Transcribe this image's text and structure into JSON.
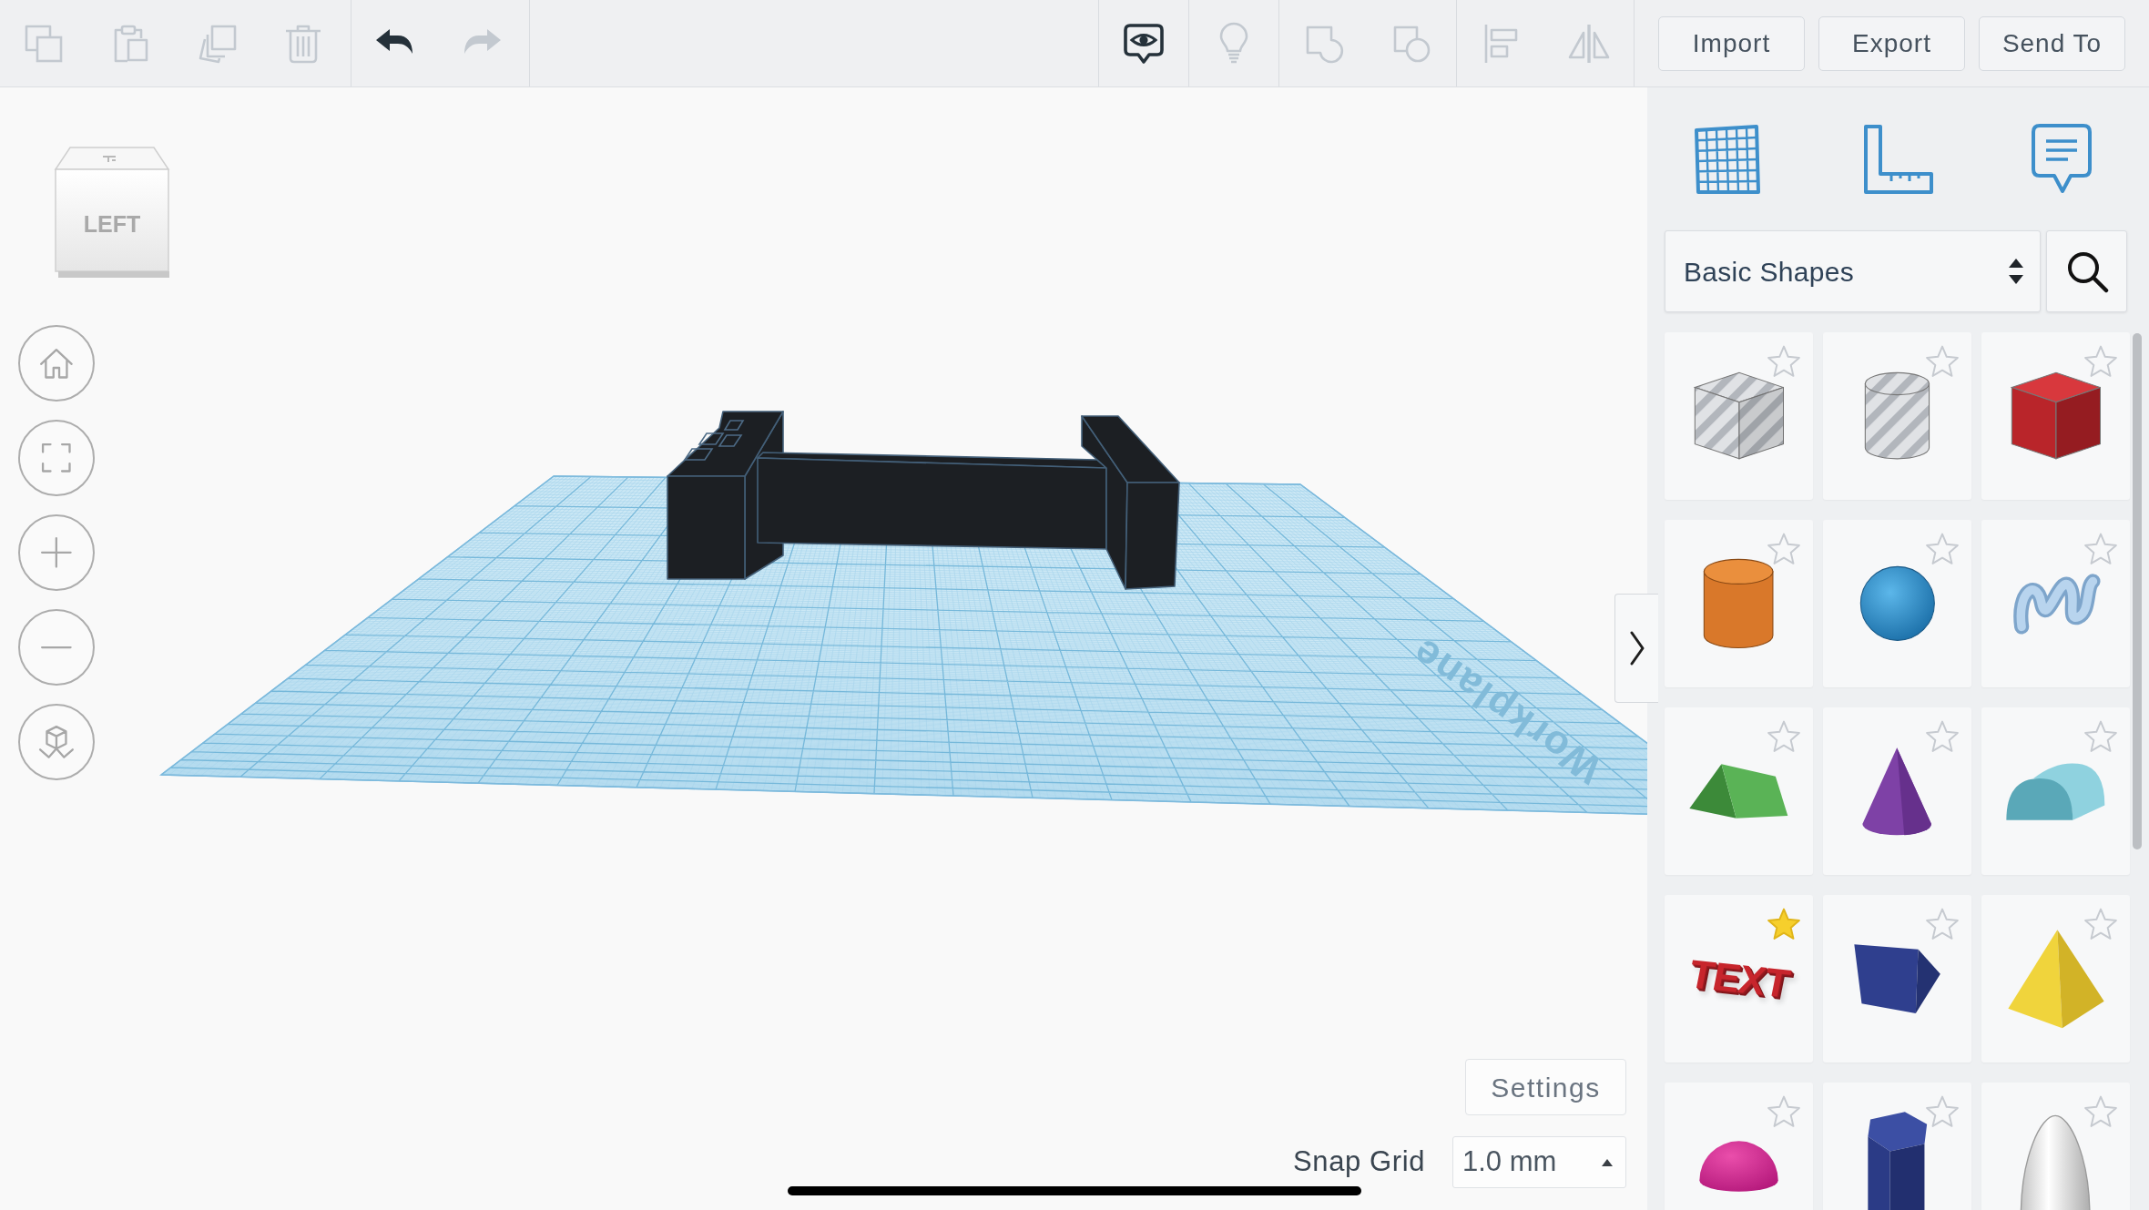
{
  "toolbar": {
    "left_groups": [
      {
        "tools": [
          {
            "kind": "copy",
            "disabled": true
          },
          {
            "kind": "paste",
            "disabled": true
          },
          {
            "kind": "duplicate",
            "disabled": true
          },
          {
            "kind": "delete",
            "disabled": true
          }
        ]
      },
      {
        "tools": [
          {
            "kind": "undo",
            "disabled": false
          },
          {
            "kind": "redo",
            "disabled": true
          }
        ]
      }
    ],
    "right_groups": [
      {
        "tools": [
          {
            "kind": "notes",
            "disabled": false
          }
        ]
      },
      {
        "tools": [
          {
            "kind": "hint",
            "disabled": true
          }
        ]
      },
      {
        "tools": [
          {
            "kind": "group",
            "disabled": true
          },
          {
            "kind": "ungroup",
            "disabled": true
          }
        ]
      },
      {
        "tools": [
          {
            "kind": "align",
            "disabled": true
          },
          {
            "kind": "mirror",
            "disabled": true
          }
        ]
      }
    ],
    "buttons": [
      "Import",
      "Export",
      "Send To"
    ]
  },
  "viewport": {
    "view_cube": {
      "face": "LEFT"
    },
    "nav_buttons": [
      {
        "kind": "home"
      },
      {
        "kind": "fit"
      },
      {
        "kind": "zoom_in"
      },
      {
        "kind": "zoom_out"
      },
      {
        "kind": "projection"
      }
    ],
    "workplane_label": "Workplane",
    "settings_button": "Settings",
    "snap_grid": {
      "label": "Snap Grid",
      "value": "1.0 mm"
    }
  },
  "panel": {
    "views": [
      {
        "kind": "workplane"
      },
      {
        "kind": "ruler"
      },
      {
        "kind": "notes"
      }
    ],
    "library": {
      "value": "Basic Shapes"
    },
    "shapes": [
      {
        "kind": "box_hole",
        "starred": false
      },
      {
        "kind": "cylinder_hole",
        "starred": false
      },
      {
        "kind": "box",
        "starred": false
      },
      {
        "kind": "cylinder",
        "starred": false
      },
      {
        "kind": "sphere",
        "starred": false
      },
      {
        "kind": "scribble",
        "starred": false
      },
      {
        "kind": "roof",
        "starred": false
      },
      {
        "kind": "cone",
        "starred": false
      },
      {
        "kind": "round_roof",
        "starred": false
      },
      {
        "kind": "text",
        "label": "TEXT",
        "starred": true
      },
      {
        "kind": "wedge",
        "starred": false
      },
      {
        "kind": "pyramid",
        "starred": false
      },
      {
        "kind": "half_sphere",
        "starred": false
      },
      {
        "kind": "polygon",
        "starred": false
      },
      {
        "kind": "paraboloid",
        "starred": false
      }
    ]
  }
}
